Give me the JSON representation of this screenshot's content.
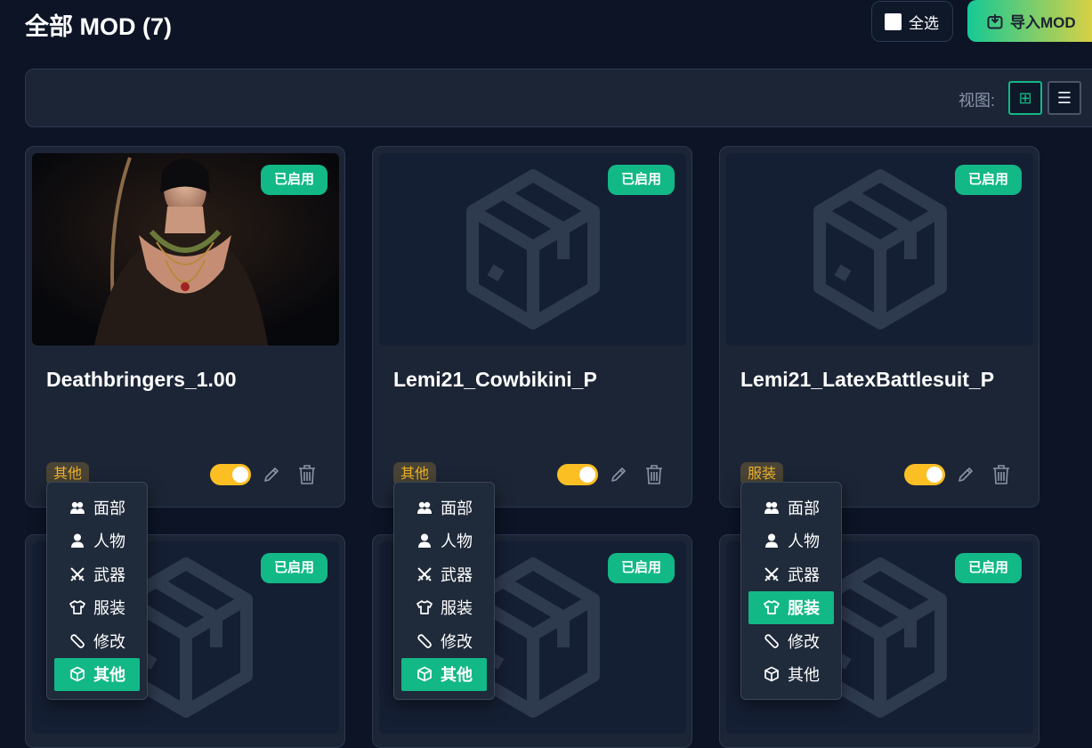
{
  "header": {
    "title": "全部 MOD (7)",
    "select_all_label": "全选",
    "import_label": "导入MOD"
  },
  "toolbar": {
    "view_label": "视图:",
    "grid_icon": "⊞",
    "list_icon": "☰"
  },
  "status_label": "已启用",
  "menu": [
    "面部",
    "人物",
    "武器",
    "服装",
    "修改",
    "其他"
  ],
  "cards": [
    {
      "name": "Deathbringers_1.00",
      "category": "其他",
      "enabled": true,
      "has_image": true
    },
    {
      "name": "Lemi21_Cowbikini_P",
      "category": "其他",
      "enabled": true,
      "has_image": false
    },
    {
      "name": "Lemi21_LatexBattlesuit_P",
      "category": "服装",
      "enabled": true,
      "has_image": false
    },
    {
      "name": "",
      "category": "",
      "enabled": true,
      "has_image": false
    },
    {
      "name": "",
      "category": "",
      "enabled": true,
      "has_image": false
    },
    {
      "name": "",
      "category": "",
      "enabled": true,
      "has_image": false
    }
  ],
  "dropdowns": [
    {
      "selected": "其他"
    },
    {
      "selected": "其他"
    },
    {
      "selected": "服装"
    }
  ],
  "colors": {
    "background": "#0c1426",
    "card": "#1c2536",
    "accent": "#12b886",
    "toggle": "#fbbf24",
    "tag": "#f0b429"
  }
}
